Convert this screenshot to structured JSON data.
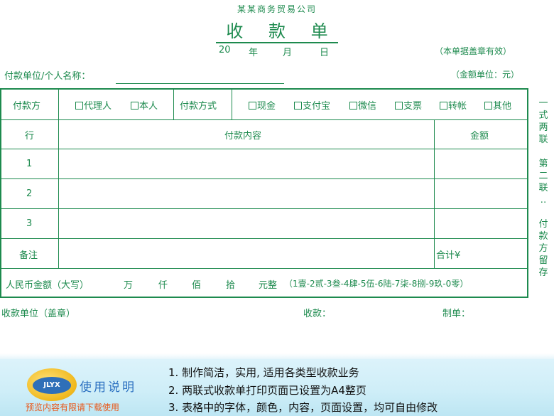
{
  "header": {
    "company": "某某商务贸易公司",
    "title": "收 款 单",
    "date": {
      "year_prefix": "20",
      "year": "年",
      "month": "月",
      "day": "日"
    },
    "note": "（本单据盖章有效）",
    "payer_label": "付款单位/个人名称：",
    "unit": "（金额单位：元）"
  },
  "form": {
    "payer_type_label": "付款方",
    "payer_options": [
      "代理人",
      "本人"
    ],
    "payment_method_label": "付款方式",
    "payment_methods": [
      "现金",
      "支付宝",
      "微信",
      "支票",
      "转帐",
      "其他"
    ],
    "col_row": "行",
    "col_content": "付款内容",
    "col_amount": "金额",
    "rows": [
      "1",
      "2",
      "3"
    ],
    "remarks_label": "备注",
    "total_label": "合计¥",
    "rmb_label": "人民币金额（大写）",
    "rmb_units": [
      "万",
      "仟",
      "佰",
      "拾",
      "元整"
    ],
    "digits_ref": "（1壹-2贰-3叁-4肆-5伍-6陆-7柒-8捌-9玖-0零）"
  },
  "side_note": [
    "一",
    "式",
    "两",
    "联",
    "",
    "第",
    "二",
    "联",
    "‥",
    "",
    "付",
    "款",
    "方",
    "留",
    "存"
  ],
  "footer": {
    "receiver_unit": "收款单位（盖章）",
    "receiver": "收款：",
    "maker": "制单："
  },
  "banner": {
    "logo_text": "JLYX",
    "usage_title": "使用说明",
    "warning": "预览内容有限请下载使用",
    "tips": [
      "1. 制作简洁，实用, 适用各类型收款业务",
      "2. 两联式收款单打印页面已设置为A4整页",
      "3. 表格中的字体，颜色，内容，页面设置，均可自由修改"
    ]
  },
  "colors": {
    "form_green": "#1d8a4e",
    "banner_bg": "#cfeef8",
    "usage_blue": "#2a6fc0",
    "warning_orange": "#e8581a"
  }
}
